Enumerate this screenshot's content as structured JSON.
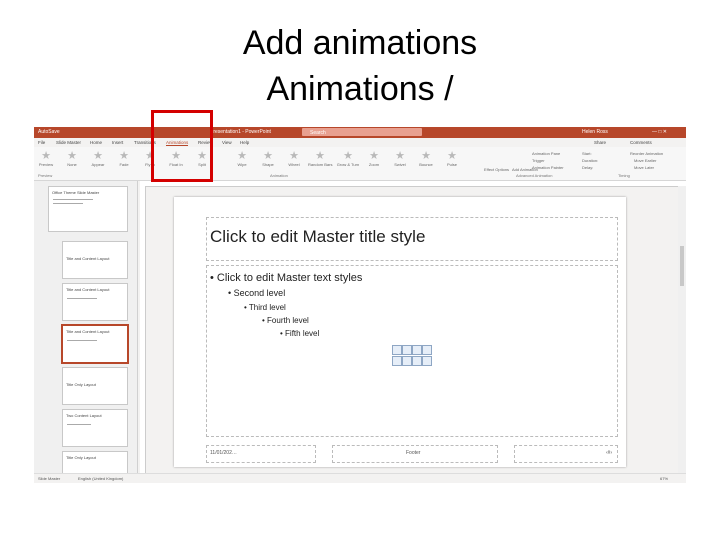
{
  "heading": {
    "line1": "Add animations",
    "line2": "Animations /"
  },
  "app": {
    "titlebar": {
      "autosave": "AutoSave",
      "doc_title": "Presentation1 - PowerPoint",
      "search": "Search",
      "user": "Helen Ross"
    },
    "tabs": [
      "File",
      "Slide Master",
      "Home",
      "Insert",
      "Transitions",
      "Animations",
      "Review",
      "View",
      "Help"
    ],
    "active_tab": "Animations",
    "ribbon": {
      "preview": "Preview",
      "animations": [
        "None",
        "Appear",
        "Fade",
        "Fly In",
        "Float In",
        "Split",
        "Wipe",
        "Shape",
        "Wheel",
        "Random Bars",
        "Grow & Turn",
        "Zoom",
        "Swivel",
        "Bounce",
        "Pulse"
      ],
      "group_preview": "Preview",
      "group_animation": "Animation",
      "group_advanced": "Advanced Animation",
      "group_timing": "Timing",
      "effect_options": "Effect Options",
      "add_animation": "Add Animation",
      "animation_pane": "Animation Pane",
      "trigger": "Trigger",
      "animation_painter": "Animation Painter",
      "start": "Start:",
      "duration": "Duration:",
      "delay": "Delay:",
      "reorder": "Reorder Animation",
      "move_earlier": "Move Earlier",
      "move_later": "Move Later",
      "share": "Share",
      "comments": "Comments"
    },
    "thumbs": [
      "Office Theme Slide Master",
      "Title and Content Layout",
      "Title and Content Layout",
      "Title and Content Layout",
      "Title Only Layout",
      "Two Content Layout",
      "Title Only Layout"
    ],
    "slide": {
      "title": "Click to edit Master title style",
      "levels": [
        "Click to edit Master text styles",
        "Second level",
        "Third level",
        "Fourth level",
        "Fifth level"
      ],
      "footer_date": "11/01/202…",
      "footer_text": "Footer",
      "footer_num": "‹#›"
    },
    "status": {
      "view": "Slide Master",
      "lang": "English (United Kingdom)",
      "zoom": "67%"
    }
  }
}
